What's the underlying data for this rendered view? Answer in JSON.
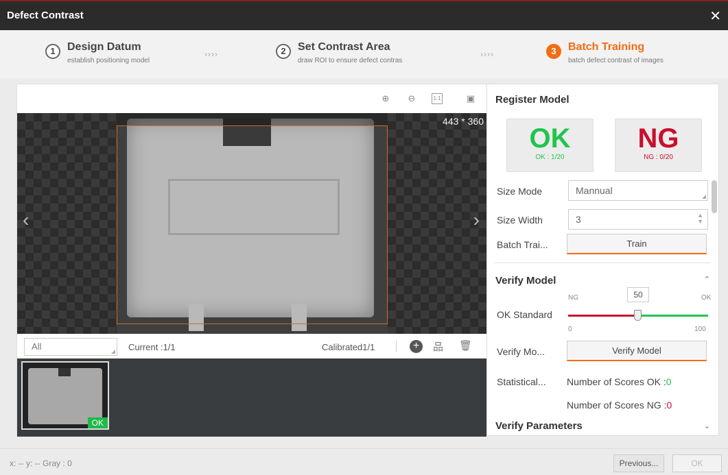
{
  "window": {
    "title": "Defect Contrast",
    "close_glyph": "✕"
  },
  "steps": [
    {
      "num": "1",
      "title": "Design Datum",
      "subtitle": "establish positioning model"
    },
    {
      "num": "2",
      "title": "Set Contrast Area",
      "subtitle": "draw ROI to ensure defect contras"
    },
    {
      "num": "3",
      "title": "Batch Training",
      "subtitle": "batch defect contrast of images"
    }
  ],
  "step_separator": "››››",
  "viewer": {
    "tools": [
      {
        "name": "zoom-in-icon",
        "glyph": "⊕"
      },
      {
        "name": "zoom-out-icon",
        "glyph": "⊖"
      },
      {
        "name": "actual-size-icon",
        "glyph": "1:1"
      },
      {
        "name": "fit-window-icon",
        "glyph": "▣"
      }
    ],
    "dimensions": "443 * 360",
    "prev_glyph": "‹",
    "next_glyph": "›"
  },
  "filter": {
    "selected": "All",
    "current_label": "Current :1/1",
    "calibrated_label": "Calibrated1/1"
  },
  "thumbnails": [
    {
      "status": "OK"
    }
  ],
  "register": {
    "title": "Register Model",
    "ok": {
      "big": "OK",
      "count": "OK : 1/20"
    },
    "ng": {
      "big": "NG",
      "count": "NG : 0/20"
    },
    "size_mode_label": "Size Mode",
    "size_mode_value": "Mannual",
    "size_width_label": "Size Width",
    "size_width_value": "3",
    "batch_label": "Batch Trai...",
    "train_button": "Train"
  },
  "verify": {
    "title": "Verify Model",
    "ok_standard_label": "OK Standard",
    "slider": {
      "value": "50",
      "value_fraction": 0.5,
      "left_label": "NG",
      "right_label": "OK",
      "min": "0",
      "max": "100"
    },
    "verify_label": "Verify Mo...",
    "verify_button": "Verify Model",
    "statistical_label": "Statistical...",
    "scores_ok_label": "Number of Scores OK :",
    "scores_ok_value": "0",
    "scores_ng_label": "Number of Scores NG :",
    "scores_ng_value": "0"
  },
  "verify_params": {
    "title": "Verify Parameters"
  },
  "status": {
    "text": "x: --   y: --    Gray : 0"
  },
  "footer": {
    "previous": "Previous...",
    "ok": "OK"
  },
  "colors": {
    "accent": "#f26c13",
    "ok": "#21c44e",
    "ng": "#c8102e"
  }
}
